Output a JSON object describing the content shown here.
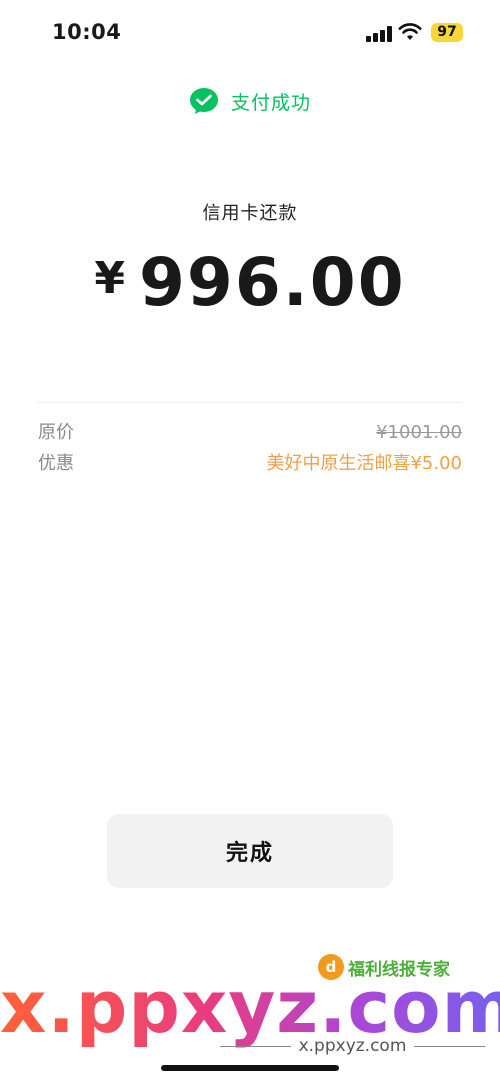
{
  "status_bar": {
    "time": "10:04",
    "battery": "97"
  },
  "header": {
    "status_text": "支付成功",
    "status_color": "#07c160"
  },
  "payment": {
    "merchant": "信用卡还款",
    "currency": "¥",
    "amount": "996.00"
  },
  "details": [
    {
      "label": "原价",
      "value": "¥1001.00"
    },
    {
      "label": "优惠",
      "value": "美好中原生活邮喜¥5.00"
    }
  ],
  "actions": {
    "done_label": "完成"
  },
  "watermark": {
    "badge_text": "福利线报专家",
    "big_text": "x.ppxyz.com",
    "small_text": "x.ppxyz.com"
  }
}
